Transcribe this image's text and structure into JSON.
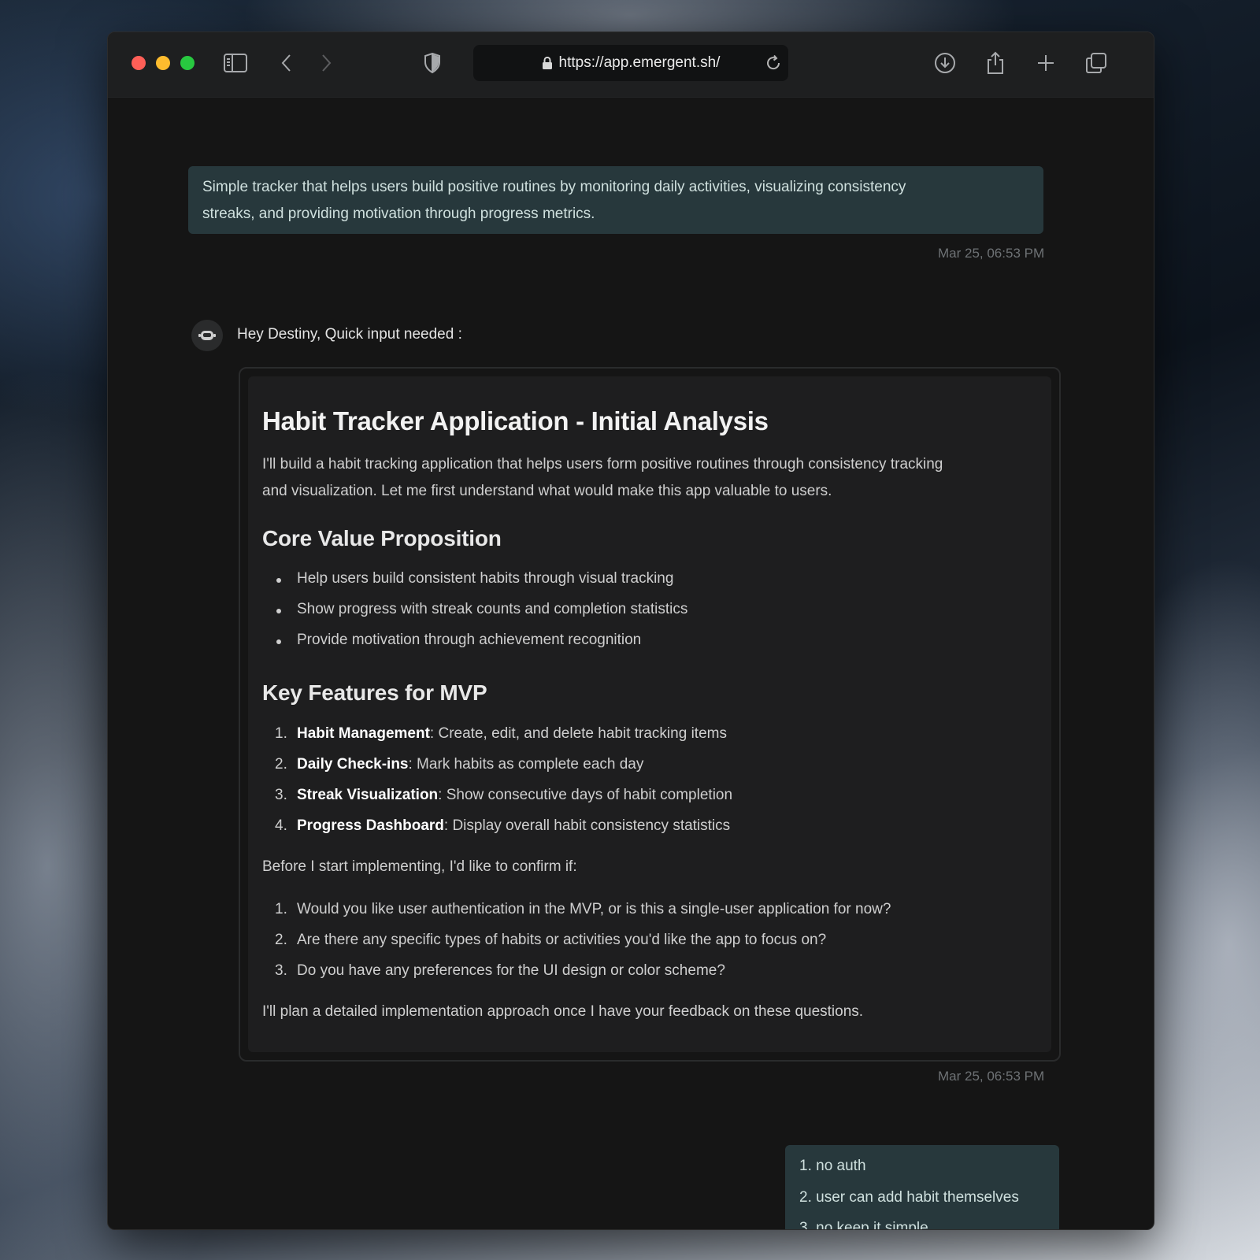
{
  "browser": {
    "url": "https://app.emergent.sh/"
  },
  "chat": {
    "prompt": {
      "line1": "Simple tracker that helps users build positive routines by monitoring daily activities, visualizing consistency",
      "line2": "streaks, and providing motivation through progress metrics.",
      "timestamp": "Mar 25, 06:53 PM"
    },
    "assistant": {
      "greeting": "Hey Destiny, Quick input needed :",
      "title": "Habit Tracker Application - Initial Analysis",
      "intro_line1": "I'll build a habit tracking application that helps users form positive routines through consistency tracking",
      "intro_line2": "and visualization. Let me first understand what would make this app valuable to users.",
      "section1_title": "Core Value Proposition",
      "bullets": [
        "Help users build consistent habits through visual tracking",
        "Show progress with streak counts and completion statistics",
        "Provide motivation through achievement recognition"
      ],
      "section2_title": "Key Features for MVP",
      "features": [
        {
          "num": "1.",
          "name": "Habit Management",
          "desc": ": Create, edit, and delete habit tracking items"
        },
        {
          "num": "2.",
          "name": "Daily Check-ins",
          "desc": ": Mark habits as complete each day"
        },
        {
          "num": "3.",
          "name": "Streak Visualization",
          "desc": ": Show consecutive days of habit completion"
        },
        {
          "num": "4.",
          "name": "Progress Dashboard",
          "desc": ": Display overall habit consistency statistics"
        }
      ],
      "confirm_text": "Before I start implementing, I'd like to confirm if:",
      "questions": [
        {
          "num": "1.",
          "text": "Would you like user authentication in the MVP, or is this a single-user application for now?"
        },
        {
          "num": "2.",
          "text": "Are there any specific types of habits or activities you'd like the app to focus on?"
        },
        {
          "num": "3.",
          "text": "Do you have any preferences for the UI design or color scheme?"
        }
      ],
      "closing": "I'll plan a detailed implementation approach once I have your feedback on these questions.",
      "timestamp": "Mar 25, 06:53 PM"
    },
    "reply": {
      "items": [
        "1. no auth",
        "2. user can add habit themselves",
        "3. no keep it simple"
      ]
    }
  },
  "colors": {
    "user_bubble": "#27383c",
    "card_bg": "#1e1e1f",
    "window_bg": "#151515"
  },
  "icons": [
    "sidebar-icon",
    "back-icon",
    "forward-icon",
    "shield-icon",
    "lock-icon",
    "reload-icon",
    "download-icon",
    "share-icon",
    "new-tab-icon",
    "tabs-overview-icon",
    "bot-avatar-icon"
  ]
}
